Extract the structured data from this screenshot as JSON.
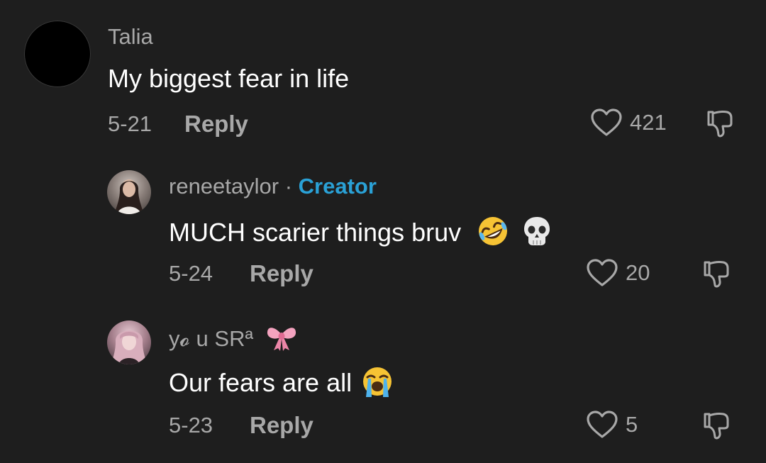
{
  "comments": [
    {
      "username": "Talia",
      "text": "My biggest fear in life",
      "date": "5-21",
      "reply_label": "Reply",
      "likes": "421"
    },
    {
      "username": "reneetaylor",
      "separator": "·",
      "badge": "Creator",
      "text": "MUCH scarier things bruv",
      "emojis": [
        "rolling-on-floor-laughing-emoji",
        "skull-emoji"
      ],
      "date": "5-24",
      "reply_label": "Reply",
      "likes": "20"
    },
    {
      "username": "y𝓸 u SRª",
      "username_emoji": "ribbon-emoji",
      "text": "Our fears are all",
      "emojis": [
        "loudly-crying-face-emoji"
      ],
      "date": "5-23",
      "reply_label": "Reply",
      "likes": "5"
    }
  ],
  "colors": {
    "background": "#1e1e1e",
    "primary_text": "#ffffff",
    "secondary_text": "#a8a8a8",
    "creator_badge": "#2aa1d6"
  }
}
